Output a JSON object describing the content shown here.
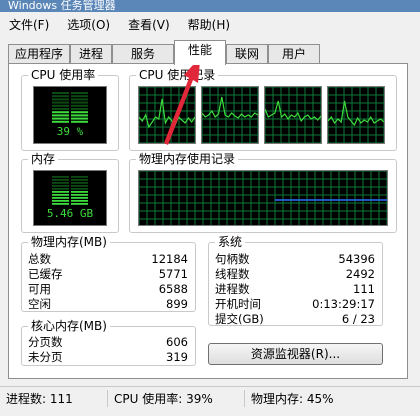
{
  "window": {
    "title": "Windows 任务管理器"
  },
  "menu": [
    "文件(F)",
    "选项(O)",
    "查看(V)",
    "帮助(H)"
  ],
  "tabs": [
    "应用程序",
    "进程",
    "服务",
    "性能",
    "联网",
    "用户"
  ],
  "cpu": {
    "title": "CPU 使用率",
    "value": "39 %",
    "level": 0.39,
    "history_title": "CPU 使用记录"
  },
  "memory": {
    "title": "内存",
    "value": "5.46 GB",
    "level": 0.45,
    "history_title": "物理内存使用记录"
  },
  "physical_memory": {
    "title": "物理内存(MB)",
    "rows": [
      {
        "label": "总数",
        "value": "12184"
      },
      {
        "label": "已缓存",
        "value": "5771"
      },
      {
        "label": "可用",
        "value": "6588"
      },
      {
        "label": "空闲",
        "value": "899"
      }
    ]
  },
  "kernel_memory": {
    "title": "核心内存(MB)",
    "rows": [
      {
        "label": "分页数",
        "value": "606"
      },
      {
        "label": "未分页",
        "value": "319"
      }
    ]
  },
  "system": {
    "title": "系统",
    "rows": [
      {
        "label": "句柄数",
        "value": "54396"
      },
      {
        "label": "线程数",
        "value": "2492"
      },
      {
        "label": "进程数",
        "value": "111"
      },
      {
        "label": "开机时间",
        "value": "0:13:29:17"
      },
      {
        "label": "提交(GB)",
        "value": "6 / 23"
      }
    ]
  },
  "resource_monitor_button": "资源监视器(R)...",
  "status": {
    "processes": "进程数: 111",
    "cpu": "CPU 使用率: 39%",
    "memory": "物理内存: 45%"
  },
  "colors": {
    "graph_green": "#3ddc3d",
    "graph_grid": "#0a7a3a",
    "mem_line": "#2f6fff",
    "arrow": "#e0283a"
  }
}
